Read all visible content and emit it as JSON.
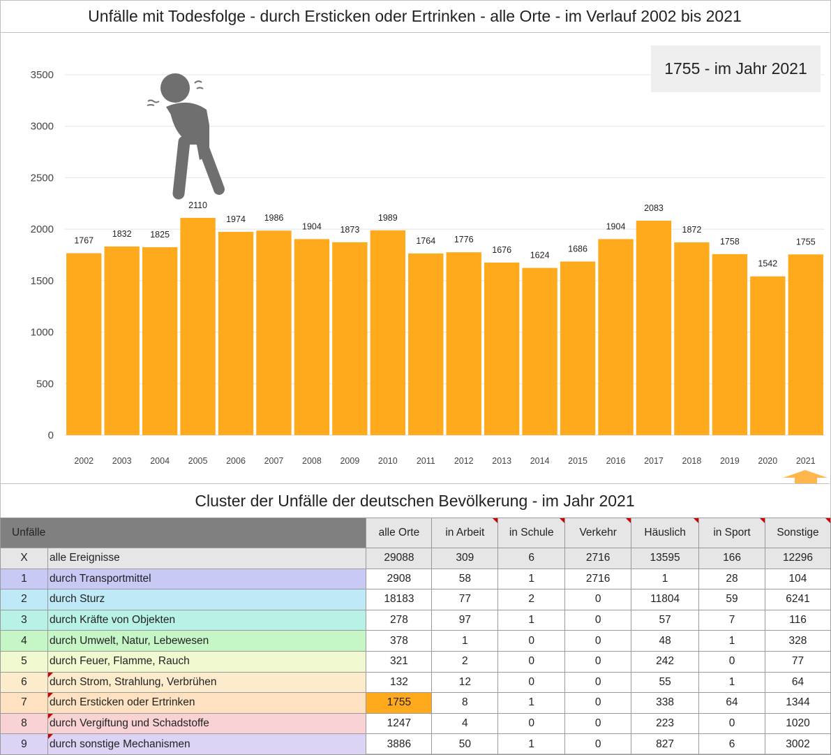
{
  "title": "Unfälle mit Todesfolge - durch Ersticken oder Ertrinken - alle Orte - im Verlauf 2002 bis 2021",
  "callout": "1755 - im Jahr 2021",
  "colors": {
    "bar": "#FFAA1D",
    "highlight": "#FFAA1D",
    "figure": "#6f6f6f",
    "arrow": "#FFB74D"
  },
  "icons": {
    "figure": "choking-person-icon",
    "arrow": "up-arrow-icon"
  },
  "chart_data": {
    "type": "bar",
    "title": "Unfälle mit Todesfolge - durch Ersticken oder Ertrinken - alle Orte - im Verlauf 2002 bis 2021",
    "categories": [
      "2002",
      "2003",
      "2004",
      "2005",
      "2006",
      "2007",
      "2008",
      "2009",
      "2010",
      "2011",
      "2012",
      "2013",
      "2014",
      "2015",
      "2016",
      "2017",
      "2018",
      "2019",
      "2020",
      "2021"
    ],
    "values": [
      1767,
      1832,
      1825,
      2110,
      1974,
      1986,
      1904,
      1873,
      1989,
      1764,
      1776,
      1676,
      1624,
      1686,
      1904,
      2083,
      1872,
      1758,
      1542,
      1755
    ],
    "yticks": [
      0,
      500,
      1000,
      1500,
      2000,
      2500,
      3000,
      3500
    ],
    "ylim": [
      0,
      3500
    ],
    "grid": true,
    "data_labels": true,
    "xlabel": "",
    "ylabel": ""
  },
  "table": {
    "title": "Cluster der Unfälle der deutschen Bevölkerung - im Jahr 2021",
    "header_label": "Unfälle",
    "columns": [
      "alle Orte",
      "in Arbeit",
      "in Schule",
      "Verkehr",
      "Häuslich",
      "in Sport",
      "Sonstige"
    ],
    "rows": [
      {
        "idx": "X",
        "label": "alle Ereignisse",
        "color": "#e6e6e6",
        "values": [
          "29088",
          "309",
          "6",
          "2716",
          "13595",
          "166",
          "12296"
        ]
      },
      {
        "idx": "1",
        "label": "durch Transportmittel",
        "color": "#c9c9f5",
        "values": [
          "2908",
          "58",
          "1",
          "2716",
          "1",
          "28",
          "104"
        ]
      },
      {
        "idx": "2",
        "label": "durch Sturz",
        "color": "#bfe9f7",
        "values": [
          "18183",
          "77",
          "2",
          "0",
          "11804",
          "59",
          "6241"
        ]
      },
      {
        "idx": "3",
        "label": "durch Kräfte von Objekten",
        "color": "#b8f2e6",
        "values": [
          "278",
          "97",
          "1",
          "0",
          "57",
          "7",
          "116"
        ]
      },
      {
        "idx": "4",
        "label": "durch Umwelt, Natur, Lebewesen",
        "color": "#c6f5c6",
        "values": [
          "378",
          "1",
          "0",
          "0",
          "48",
          "1",
          "328"
        ]
      },
      {
        "idx": "5",
        "label": "durch Feuer, Flamme, Rauch",
        "color": "#f0f9d0",
        "values": [
          "321",
          "2",
          "0",
          "0",
          "242",
          "0",
          "77"
        ]
      },
      {
        "idx": "6",
        "label": "durch Strom, Strahlung, Verbrühen",
        "color": "#fdeccb",
        "values": [
          "132",
          "12",
          "0",
          "0",
          "55",
          "1",
          "64"
        ]
      },
      {
        "idx": "7",
        "label": "durch Ersticken oder Ertrinken",
        "color": "#fde1c0",
        "values": [
          "1755",
          "8",
          "1",
          "0",
          "338",
          "64",
          "1344"
        ],
        "highlight": true
      },
      {
        "idx": "8",
        "label": "durch Vergiftung und Schadstoffe",
        "color": "#f9d3d3",
        "values": [
          "1247",
          "4",
          "0",
          "0",
          "223",
          "0",
          "1020"
        ]
      },
      {
        "idx": "9",
        "label": "durch sonstige Mechanismen",
        "color": "#ddd3f5",
        "values": [
          "3886",
          "50",
          "1",
          "0",
          "827",
          "6",
          "3002"
        ]
      }
    ]
  }
}
